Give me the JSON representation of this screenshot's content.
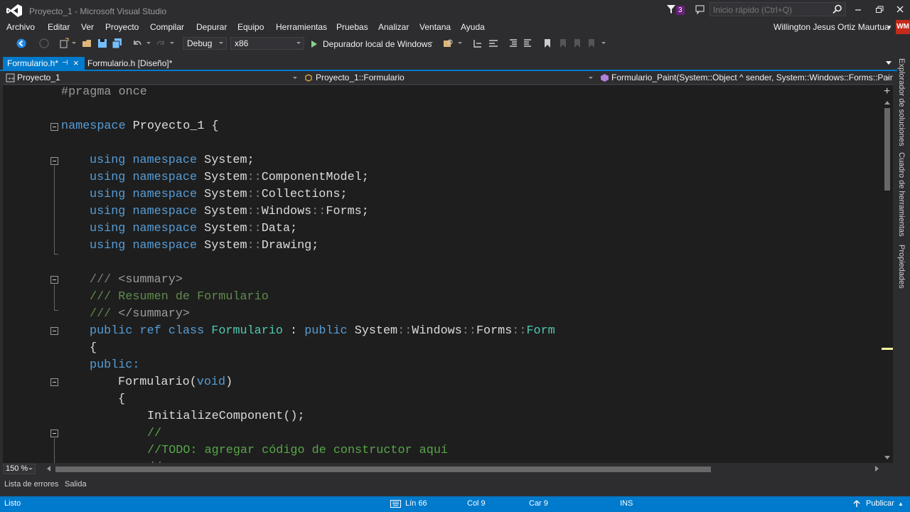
{
  "window": {
    "title": "Proyecto_1 - Microsoft Visual Studio",
    "notification_count": "3",
    "quick_launch_placeholder": "Inicio rápido (Ctrl+Q)"
  },
  "menu": {
    "items": [
      "Archivo",
      "Editar",
      "Ver",
      "Proyecto",
      "Compilar",
      "Depurar",
      "Equipo",
      "Herramientas",
      "Pruebas",
      "Analizar",
      "Ventana",
      "Ayuda"
    ]
  },
  "user": {
    "name": "Willington Jesus Ortiz Maurtua",
    "initials": "WM"
  },
  "toolbar": {
    "configuration": "Debug",
    "platform": "x86",
    "debugger_label": "Depurador local de Windows"
  },
  "tabs": [
    {
      "label": "Formulario.h*",
      "active": true
    },
    {
      "label": "Formulario.h [Diseño]*",
      "active": false
    }
  ],
  "navbar": {
    "project": "Proyecto_1",
    "scope": "Proyecto_1::Formulario",
    "member": "Formulario_Paint(System::Object ^ sender, System::Windows::Forms::PaintEv"
  },
  "zoom": "150 %",
  "bottom_panel": {
    "tabs": [
      "Lista de errores",
      "Salida"
    ]
  },
  "side_panels": [
    "Explorador de soluciones",
    "Cuadro de herramientas",
    "Propiedades"
  ],
  "status": {
    "state": "Listo",
    "line": "Lín 66",
    "col": "Col 9",
    "char": "Car 9",
    "mode": "INS",
    "publish": "Publicar"
  },
  "code": {
    "l1": "#pragma once",
    "l2_kw": "namespace",
    "l2_rest": " Proyecto_1 {",
    "using_kw1": "using",
    "using_kw2": "namespace",
    "u1": " System;",
    "u2a": " System",
    "u2b": "::",
    "u2c": "ComponentModel;",
    "u3a": " System",
    "u3b": "::",
    "u3c": "Collections;",
    "u4a": " System",
    "u4b": "::",
    "u4c": "Windows",
    "u4d": "::",
    "u4e": "Forms;",
    "u5a": " System",
    "u5b": "::",
    "u5c": "Data;",
    "u6a": " System",
    "u6b": "::",
    "u6c": "Drawing;",
    "doc_slash": "///",
    "doc1": " <summary>",
    "doc2": " Resumen de Formulario",
    "doc3": " </summary>",
    "class_public": "public",
    "class_ref": "ref",
    "class_class": "class",
    "class_name": "Formulario",
    "class_colon": " : ",
    "class_public2": "public",
    "class_base1": " System",
    "class_base2": "::",
    "class_base3": "Windows",
    "class_base4": "::",
    "class_base5": "Forms",
    "class_base6": "::",
    "class_base7": "Form",
    "open_brace": "{",
    "public_label": "public:",
    "ctor_name": "Formulario(",
    "ctor_void": "void",
    "ctor_close": ")",
    "ctor_brace": "{",
    "init_call": "InitializeComponent();",
    "cmt1": "//",
    "cmt2": "//TODO: agregar código de constructor aquí",
    "cmt3": "//"
  }
}
